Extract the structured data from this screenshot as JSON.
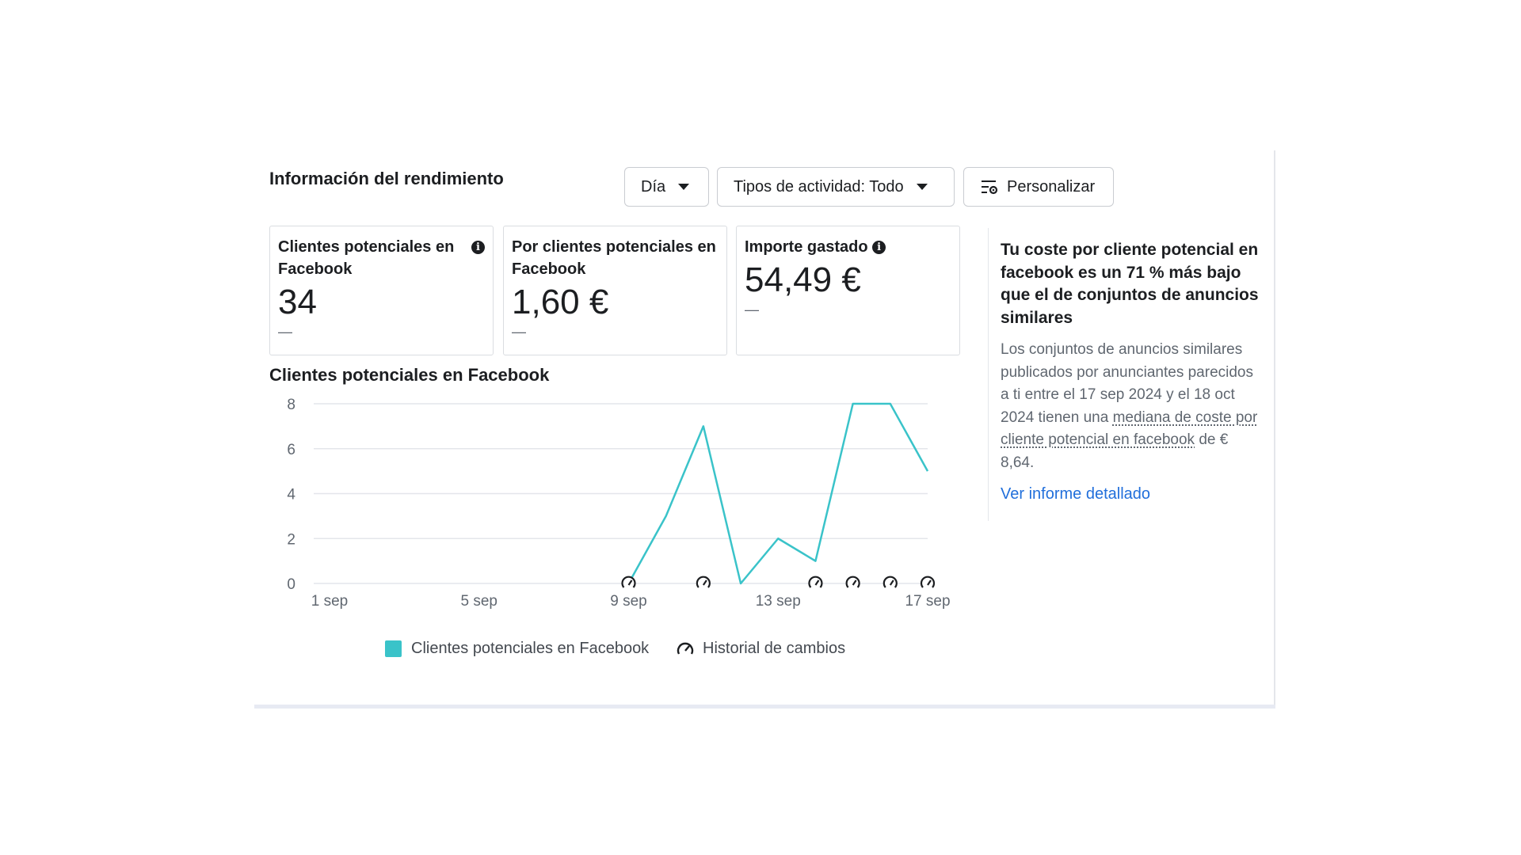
{
  "header": {
    "title": "Información del rendimiento",
    "day_button": "Día",
    "activity_button": "Tipos de actividad: Todo",
    "customize_button": "Personalizar"
  },
  "cards": [
    {
      "label": "Clientes potenciales en Facebook",
      "value": "34",
      "change": "—"
    },
    {
      "label": "Por clientes potenciales en Facebook",
      "value": "1,60 €",
      "change": "—"
    },
    {
      "label": "Importe gastado",
      "value": "54,49 €",
      "change": "—"
    }
  ],
  "chart_title": "Clientes potenciales en Facebook",
  "chart_data": {
    "type": "line",
    "x": [
      "9 sep",
      "10 sep",
      "11 sep",
      "12 sep",
      "13 sep",
      "14 sep",
      "15 sep",
      "16 sep",
      "17 sep"
    ],
    "x_tick_labels": [
      "1 sep",
      "5 sep",
      "9 sep",
      "13 sep",
      "17 sep"
    ],
    "x_range": [
      "1 sep",
      "17 sep"
    ],
    "series": [
      {
        "name": "Clientes potenciales en Facebook",
        "values": [
          0,
          3,
          7,
          0,
          2,
          1,
          8,
          8,
          5
        ],
        "color": "#3ac3c9"
      }
    ],
    "change_markers": [
      "9 sep",
      "11 sep",
      "14 sep",
      "15 sep",
      "16 sep",
      "17 sep"
    ],
    "y_ticks": [
      0,
      2,
      4,
      6,
      8
    ],
    "ylim": [
      0,
      8
    ],
    "grid": true,
    "legend": [
      {
        "label": "Clientes potenciales en Facebook",
        "icon": "teal-square"
      },
      {
        "label": "Historial de cambios",
        "icon": "gauge-icon"
      }
    ],
    "legend_position": "bottom"
  },
  "insight": {
    "headline": "Tu coste por cliente potencial en facebook es un 71 % más bajo que el de conjuntos de anuncios similares",
    "body_before": "Los conjuntos de anuncios similares publicados por anunciantes parecidos a ti entre el 17 sep 2024 y el 18 oct 2024 tienen una ",
    "body_link": "mediana de coste por cliente potencial en facebook",
    "body_after": " de € 8,64.",
    "report_link": "Ver informe detallado"
  },
  "colors": {
    "series": "#3ac3c9",
    "link": "#216fdb",
    "grid": "#e4e6eb"
  }
}
